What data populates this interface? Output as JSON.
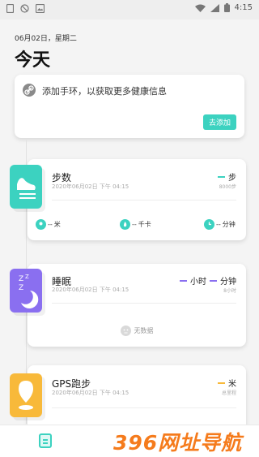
{
  "statusbar": {
    "time": "4:15"
  },
  "header": {
    "date": "06月02日，星期二",
    "title": "今天"
  },
  "pair_card": {
    "text": "添加手环，以获取更多健康信息",
    "button": "去添加"
  },
  "steps_card": {
    "title": "步数",
    "time": "2020年06月02日 下午 04:15",
    "value": "--",
    "unit": "步",
    "goal": "8000步",
    "stats": [
      {
        "icon": "location-icon",
        "value": "--",
        "unit": "米"
      },
      {
        "icon": "flame-icon",
        "value": "--",
        "unit": "千卡"
      },
      {
        "icon": "clock-icon",
        "value": "--",
        "unit": "分钟"
      }
    ],
    "colors": {
      "accent": "#3cd2c0"
    }
  },
  "sleep_card": {
    "title": "睡眠",
    "time": "2020年06月02日 下午 04:15",
    "hours_value": "--",
    "hours_unit": "小时",
    "minutes_value": "--",
    "minutes_unit": "分钟",
    "goal": "8小时",
    "no_data": "无数据",
    "colors": {
      "accent": "#8a6ff0"
    }
  },
  "gps_card": {
    "title": "GPS跑步",
    "time": "2020年06月02日 下午 04:15",
    "value": "--",
    "unit": "米",
    "sub": "总里程",
    "colors": {
      "accent": "#f8b93a"
    }
  },
  "watermark": "396网址导航"
}
